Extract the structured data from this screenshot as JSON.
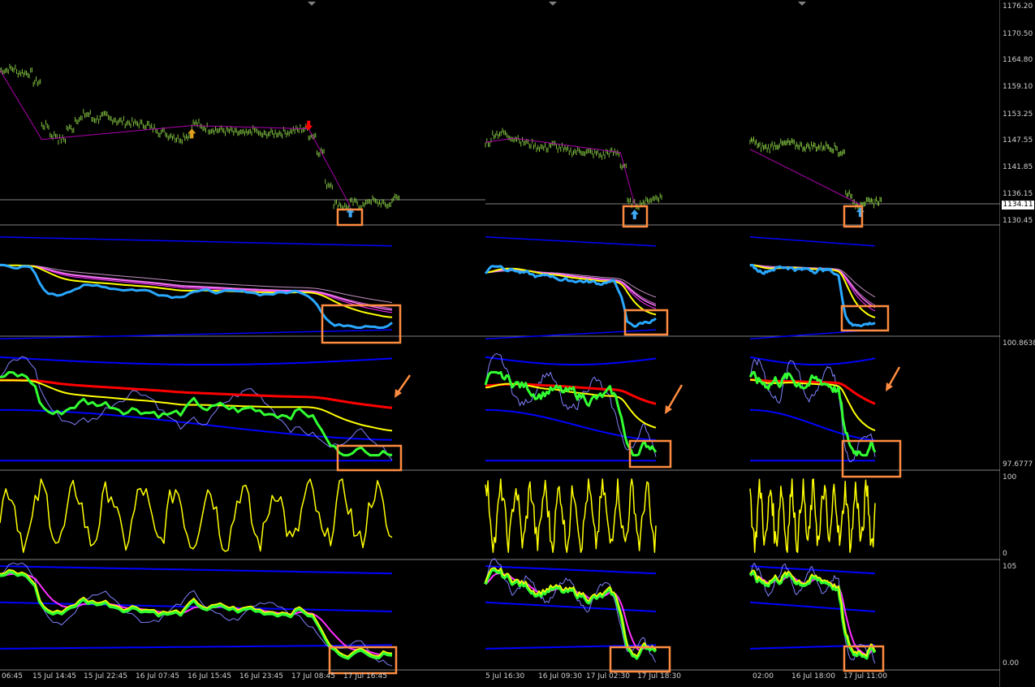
{
  "colors": {
    "background": "#000000",
    "grid_line": "#808080",
    "price_bars": "#7fbf3f",
    "zigzag": "#b000b0",
    "band": "#0000ff",
    "yellow": "#ffff00",
    "red": "#ff0000",
    "green": "#32ff32",
    "cyan": "#2aa8ff",
    "magenta": "#ff30ff",
    "highlight_box": "#ff8c40",
    "arrow_up": "#3fa9f5",
    "arrow_down": "#ff0000"
  },
  "price_scale": {
    "ticks": [
      "1176.20",
      "1170.50",
      "1164.80",
      "1159.10",
      "1153.25",
      "1147.55",
      "1141.85",
      "1136.15",
      "1130.45"
    ],
    "current_price": "1134.11"
  },
  "indicator_scales": {
    "panel3": [
      "100.8638",
      "97.6777"
    ],
    "panel4": [
      "100",
      "0"
    ],
    "panel5": [
      "105",
      "0.00"
    ]
  },
  "time_axis": {
    "labels": [
      "06:45",
      "15 Jul 14:45",
      "15 Jul 22:45",
      "16 Jul 07:45",
      "16 Jul 15:45",
      "16 Jul 23:45",
      "17 Jul 08:45",
      "17 Jul 16:45",
      "5 Jul 16:30",
      "16 Jul 09:30",
      "17 Jul 02:30",
      "17 Jul 18:30",
      "02:00",
      "16 Jul 18:00",
      "17 Jul 11:00"
    ]
  },
  "chart_data": {
    "type": "line",
    "description_units": "price chart with 4 indicator sub-panels, three timeframe segments",
    "price_ylim": [
      1130.45,
      1176.2
    ],
    "segments": [
      {
        "close": [
          1162.5,
          1162.8,
          1162.0,
          1161.9,
          1160.0,
          1150.6,
          1148.5,
          1147.6,
          1150.0,
          1152.0,
          1153.0,
          1152.0,
          1152.6,
          1152.0,
          1151.5,
          1151.2,
          1151.0,
          1150.8,
          1150.0,
          1149.2,
          1148.5,
          1147.8,
          1148.4,
          1151.0,
          1150.2,
          1149.8,
          1149.6,
          1149.4,
          1149.0,
          1148.8,
          1149.5,
          1148.6,
          1148.9,
          1149.0,
          1149.2,
          1149.6,
          1149.9,
          1148.5,
          1145.0,
          1138.0,
          1133.7,
          1133.2,
          1134.0,
          1133.4,
          1134.5,
          1134.0,
          1133.5,
          1135.0
        ]
      },
      {
        "close": [
          1147.0,
          1148.8,
          1149.0,
          1148.2,
          1147.9,
          1147.0,
          1146.6,
          1146.0,
          1145.8,
          1146.4,
          1145.8,
          1145.2,
          1145.0,
          1145.1,
          1144.8,
          1144.6,
          1144.2,
          1144.8,
          1144.7,
          1142.0,
          1134.0,
          1133.6,
          1134.2,
          1134.8,
          1135.2
        ]
      },
      {
        "close": [
          1147.2,
          1146.0,
          1145.8,
          1146.4,
          1146.6,
          1146.8,
          1146.4,
          1146.0,
          1146.2,
          1146.0,
          1146.2,
          1145.8,
          1144.8,
          1136.0,
          1133.6,
          1134.1,
          1134.0,
          1134.4
        ]
      }
    ],
    "sub_panels": [
      {
        "name": "moving-average-ribbon"
      },
      {
        "name": "bands-and-ma",
        "ylim": [
          97.6777,
          100.8638
        ]
      },
      {
        "name": "oscillator",
        "ylim": [
          0,
          100
        ]
      },
      {
        "name": "stochastic-bands",
        "ylim": [
          0,
          105
        ]
      }
    ],
    "signals": [
      {
        "segment": 0,
        "type": "buy",
        "index": 23
      },
      {
        "segment": 0,
        "type": "sell",
        "index": 37
      },
      {
        "segment": 0,
        "type": "buy",
        "index": 42
      },
      {
        "segment": 1,
        "type": "buy",
        "index": 21
      },
      {
        "segment": 2,
        "type": "buy",
        "index": 15
      }
    ],
    "grid": false,
    "legend": "none"
  }
}
